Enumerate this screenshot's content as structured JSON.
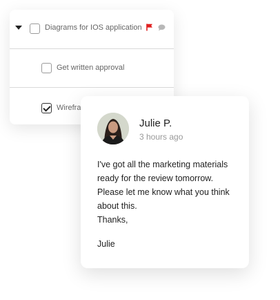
{
  "task_list": {
    "tasks": [
      {
        "label": "Diagrams for IOS application",
        "checked": false,
        "expanded": true,
        "flag_color": "#e02020"
      },
      {
        "label": "Get written approval",
        "checked": false
      },
      {
        "label": "Wirefra",
        "checked": true
      }
    ]
  },
  "comment": {
    "author": "Julie P.",
    "time": "3 hours ago",
    "message_lines": [
      "I've got all the marketing materials",
      "ready for the review tomorrow.",
      "Please let me know what you think",
      "about this.",
      "Thanks,"
    ],
    "signature": "Julie"
  }
}
